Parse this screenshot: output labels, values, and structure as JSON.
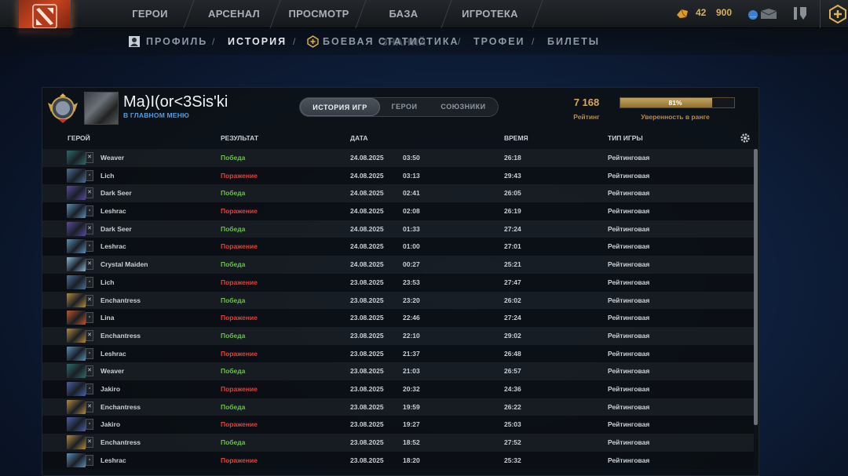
{
  "nav": {
    "tabs": [
      "ГЕРОИ",
      "АРСЕНАЛ",
      "ПРОСМОТР",
      "БАЗА ЗНАНИЙ",
      "ИГРОТЕКА"
    ],
    "currency_amount": "42",
    "currency_amount2": "900"
  },
  "subnav": {
    "items": [
      "ПРОФИЛЬ",
      "ИСТОРИЯ",
      "БОЕВАЯ СТАТИСТИКА",
      "ТРОФЕИ",
      "БИЛЕТЫ"
    ],
    "active": "ИСТОРИЯ"
  },
  "profile": {
    "name": "Ma)I(or<3Sis'ki",
    "status": "В ГЛАВНОМ МЕНЮ",
    "rating": "7 168",
    "rating_label": "Рейтинг",
    "confidence_pct": 81,
    "confidence_text": "81%",
    "confidence_label": "Уверенность в ранге"
  },
  "segment_tabs": [
    "ИСТОРИЯ ИГР",
    "ГЕРОИ",
    "СОЮЗНИКИ"
  ],
  "table": {
    "headers": [
      "ГЕРОЙ",
      "РЕЗУЛЬТАТ",
      "ДАТА",
      "ВРЕМЯ",
      "ТИП ИГРЫ"
    ],
    "rows": [
      {
        "hero": "Weaver",
        "result": "Победа",
        "win": true,
        "date": "24.08.2025",
        "time": "03:50",
        "duration": "26:18",
        "type": "Рейтинговая"
      },
      {
        "hero": "Lich",
        "result": "Поражение",
        "win": false,
        "date": "24.08.2025",
        "time": "03:13",
        "duration": "29:43",
        "type": "Рейтинговая"
      },
      {
        "hero": "Dark Seer",
        "result": "Победа",
        "win": true,
        "date": "24.08.2025",
        "time": "02:41",
        "duration": "26:05",
        "type": "Рейтинговая"
      },
      {
        "hero": "Leshrac",
        "result": "Поражение",
        "win": false,
        "date": "24.08.2025",
        "time": "02:08",
        "duration": "26:19",
        "type": "Рейтинговая"
      },
      {
        "hero": "Dark Seer",
        "result": "Победа",
        "win": true,
        "date": "24.08.2025",
        "time": "01:33",
        "duration": "27:24",
        "type": "Рейтинговая"
      },
      {
        "hero": "Leshrac",
        "result": "Поражение",
        "win": false,
        "date": "24.08.2025",
        "time": "01:00",
        "duration": "27:01",
        "type": "Рейтинговая"
      },
      {
        "hero": "Crystal Maiden",
        "result": "Победа",
        "win": true,
        "date": "24.08.2025",
        "time": "00:27",
        "duration": "25:21",
        "type": "Рейтинговая"
      },
      {
        "hero": "Lich",
        "result": "Поражение",
        "win": false,
        "date": "23.08.2025",
        "time": "23:53",
        "duration": "27:47",
        "type": "Рейтинговая"
      },
      {
        "hero": "Enchantress",
        "result": "Победа",
        "win": true,
        "date": "23.08.2025",
        "time": "23:20",
        "duration": "26:02",
        "type": "Рейтинговая"
      },
      {
        "hero": "Lina",
        "result": "Поражение",
        "win": false,
        "date": "23.08.2025",
        "time": "22:46",
        "duration": "27:24",
        "type": "Рейтинговая"
      },
      {
        "hero": "Enchantress",
        "result": "Победа",
        "win": true,
        "date": "23.08.2025",
        "time": "22:10",
        "duration": "29:02",
        "type": "Рейтинговая"
      },
      {
        "hero": "Leshrac",
        "result": "Поражение",
        "win": false,
        "date": "23.08.2025",
        "time": "21:37",
        "duration": "26:48",
        "type": "Рейтинговая"
      },
      {
        "hero": "Weaver",
        "result": "Победа",
        "win": true,
        "date": "23.08.2025",
        "time": "21:03",
        "duration": "26:57",
        "type": "Рейтинговая"
      },
      {
        "hero": "Jakiro",
        "result": "Поражение",
        "win": false,
        "date": "23.08.2025",
        "time": "20:32",
        "duration": "24:36",
        "type": "Рейтинговая"
      },
      {
        "hero": "Enchantress",
        "result": "Победа",
        "win": true,
        "date": "23.08.2025",
        "time": "19:59",
        "duration": "26:22",
        "type": "Рейтинговая"
      },
      {
        "hero": "Jakiro",
        "result": "Поражение",
        "win": false,
        "date": "23.08.2025",
        "time": "19:27",
        "duration": "25:03",
        "type": "Рейтинговая"
      },
      {
        "hero": "Enchantress",
        "result": "Победа",
        "win": true,
        "date": "23.08.2025",
        "time": "18:52",
        "duration": "27:52",
        "type": "Рейтинговая"
      },
      {
        "hero": "Leshrac",
        "result": "Поражение",
        "win": false,
        "date": "23.08.2025",
        "time": "18:20",
        "duration": "25:32",
        "type": "Рейтинговая"
      }
    ]
  },
  "hero_colors": {
    "Weaver": "#2e6b6a",
    "Lich": "#4d6f9a",
    "Dark Seer": "#5a4a9e",
    "Leshrac": "#5b8fb8",
    "Crystal Maiden": "#8fb9d6",
    "Enchantress": "#b58a3c",
    "Lina": "#c0562a",
    "Jakiro": "#4a5fa8"
  },
  "colors": {
    "win": "#6ebf4a",
    "loss": "#e2403a",
    "gold": "#d8a75a"
  }
}
